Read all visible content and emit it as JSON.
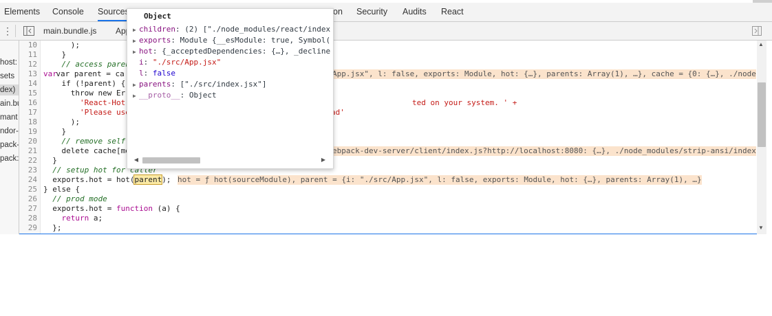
{
  "tabs": [
    "Elements",
    "Console",
    "Sources",
    "on",
    "Security",
    "Audits",
    "React"
  ],
  "active_tab": "Sources",
  "file_tabs": [
    "main.bundle.js",
    "App"
  ],
  "navigator_items": [
    "host:",
    "sets",
    "dex)",
    "ain.bu",
    "mant",
    "ndor-",
    "pack-",
    "pack:/"
  ],
  "line_numbers": [
    "10",
    "11",
    "12",
    "13",
    "14",
    "15",
    "16",
    "17",
    "18",
    "19",
    "20",
    "21",
    "22",
    "23",
    "24",
    "25",
    "26",
    "27",
    "28",
    "29"
  ],
  "code": {
    "l10": "      );",
    "l11": "    }",
    "l12": "    // access paren",
    "l13a": "    var parent = ca",
    "l14": "    if (!parent) {",
    "l15a": "      throw new Err",
    "l16a": "        'React-Hot-",
    "l16b": "ted on your system. ' +",
    "l17a": "        'Please use",
    "l17b": "ad'",
    "l18": "      );",
    "l19": "    }",
    "l20": "    // remove self",
    "l21a": "    delete cache[mo",
    "l22": "  }",
    "l23": "  // setup hot for caller",
    "l24a": "  exports.hot = hot(",
    "l24b": "parent",
    "l24c": ");",
    "l25": "} else {",
    "l26": "  // prod mode",
    "l27a": "  exports.hot = ",
    "l27b": "function",
    "l27c": " (a) {",
    "l28a": "    ",
    "l28b": "return",
    "l28c": " a;",
    "l29": "  };"
  },
  "inline_values": {
    "l13": "App.jsx\", l: false, exports: Module, hot: {…}, parents: Array(1), …}, cache = {0: {…}, ./node",
    "l21": "ebpack-dev-server/client/index.js?http://localhost:8080: {…}, ./node_modules/strip-ansi/index.",
    "l24": "hot = ƒ hot(sourceModule), parent = {i: \"./src/App.jsx\", l: false, exports: Module, hot: {…}, parents: Array(1), …}"
  },
  "popover": {
    "title": "Object",
    "rows": [
      {
        "expandable": true,
        "key": "children",
        "value": "(2) [\"./node_modules/react/index"
      },
      {
        "expandable": true,
        "key": "exports",
        "value": "Module {__esModule: true, Symbol("
      },
      {
        "expandable": true,
        "key": "hot",
        "value": "{_acceptedDependencies: {…}, _decline"
      },
      {
        "expandable": false,
        "key": "i",
        "value": "\"./src/App.jsx\""
      },
      {
        "expandable": false,
        "key": "l",
        "value": "false"
      },
      {
        "expandable": true,
        "key": "parents",
        "value": "[\"./src/index.jsx\"]"
      },
      {
        "expandable": true,
        "key": "__proto__",
        "value": "Object"
      }
    ]
  }
}
